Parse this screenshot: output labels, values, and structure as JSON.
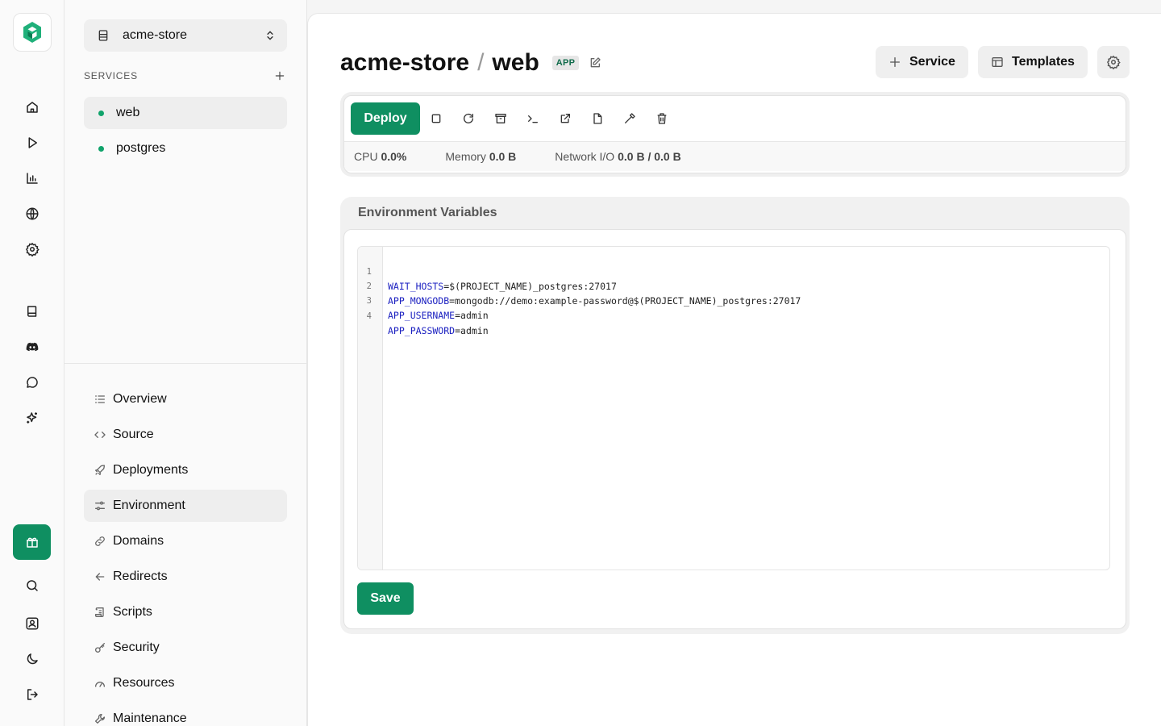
{
  "project": {
    "name": "acme-store"
  },
  "services": {
    "heading": "SERVICES",
    "items": [
      {
        "name": "web",
        "status_color": "#10a36b"
      },
      {
        "name": "postgres",
        "status_color": "#10a36b"
      }
    ]
  },
  "nav": {
    "items": [
      {
        "label": "Overview",
        "icon": "list-icon"
      },
      {
        "label": "Source",
        "icon": "code-icon"
      },
      {
        "label": "Deployments",
        "icon": "rocket-icon"
      },
      {
        "label": "Environment",
        "icon": "sliders-icon"
      },
      {
        "label": "Domains",
        "icon": "link-icon"
      },
      {
        "label": "Redirects",
        "icon": "arrow-left-icon"
      },
      {
        "label": "Scripts",
        "icon": "scroll-icon"
      },
      {
        "label": "Security",
        "icon": "key-icon"
      },
      {
        "label": "Resources",
        "icon": "gauge-icon"
      },
      {
        "label": "Maintenance",
        "icon": "wrench-icon"
      }
    ],
    "active": "Environment"
  },
  "header": {
    "project": "acme-store",
    "separator": "/",
    "service": "web",
    "badge": "APP",
    "service_button": "Service",
    "templates_button": "Templates"
  },
  "toolbar": {
    "deploy_label": "Deploy",
    "tools": [
      "stop-icon",
      "restart-icon",
      "archive-icon",
      "terminal-icon",
      "external-link-icon",
      "file-icon",
      "hammer-icon",
      "trash-icon"
    ]
  },
  "stats": {
    "cpu_label": "CPU",
    "cpu_value": "0.0%",
    "memory_label": "Memory",
    "memory_value": "0.0 B",
    "network_label": "Network I/O",
    "network_value": "0.0 B / 0.0 B"
  },
  "env": {
    "title": "Environment Variables",
    "lines": [
      {
        "n": "1",
        "key": "WAIT_HOSTS",
        "value": "=$(PROJECT_NAME)_postgres:27017"
      },
      {
        "n": "2",
        "key": "APP_MONGODB",
        "value": "=mongodb://demo:example-password@$(PROJECT_NAME)_postgres:27017"
      },
      {
        "n": "3",
        "key": "APP_USERNAME",
        "value": "=admin"
      },
      {
        "n": "4",
        "key": "APP_PASSWORD",
        "value": "=admin"
      }
    ],
    "save_label": "Save"
  },
  "colors": {
    "accent": "#0f8f61",
    "status_ok": "#10a36b",
    "env_key": "#1a1fc0"
  }
}
